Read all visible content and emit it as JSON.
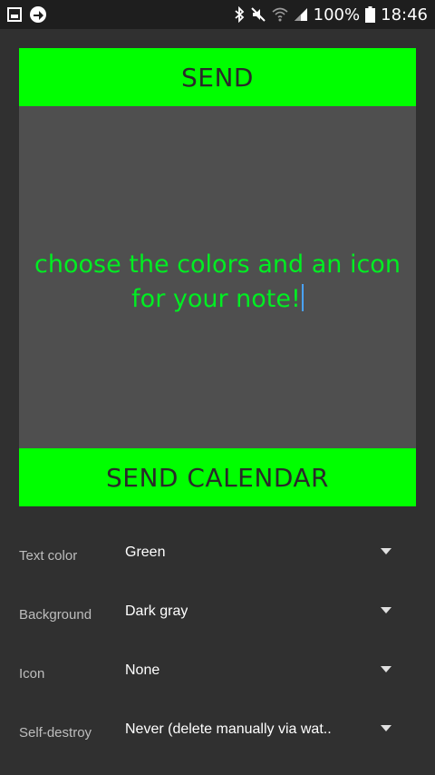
{
  "status_bar": {
    "battery_text": "100%",
    "time": "18:46",
    "icons": [
      "gallery-icon",
      "sync-icon",
      "bluetooth-icon",
      "mute-icon",
      "wifi-icon",
      "signal-icon",
      "battery-icon"
    ]
  },
  "note": {
    "send_label": "SEND",
    "text": "choose the colors and an icon for your note!",
    "send_calendar_label": "SEND CALENDAR",
    "colors": {
      "button_bg": "#00ff00",
      "note_bg": "#4f4f4f",
      "text_color": "#00ee22"
    }
  },
  "settings": {
    "text_color": {
      "label": "Text color",
      "value": "Green"
    },
    "background": {
      "label": "Background",
      "value": "Dark gray"
    },
    "icon": {
      "label": "Icon",
      "value": "None"
    },
    "self_destroy": {
      "label": "Self-destroy",
      "value": "Never (delete manually via wat.."
    }
  }
}
